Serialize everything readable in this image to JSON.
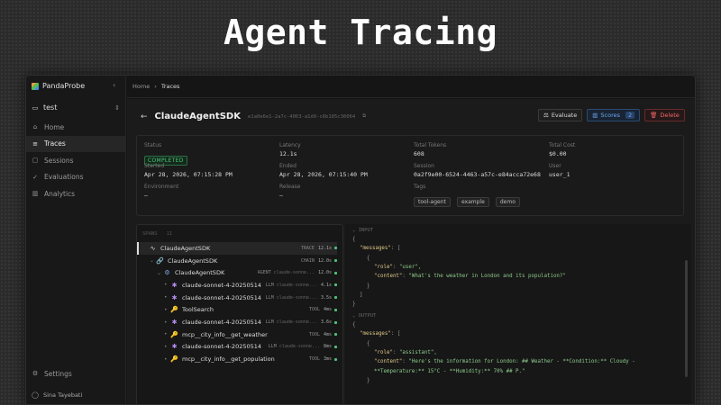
{
  "headline": "Agent Tracing",
  "brand": "PandaProbe",
  "project": "test",
  "nav": [
    {
      "label": "Home",
      "icon": "home-icon"
    },
    {
      "label": "Traces",
      "icon": "traces-icon"
    },
    {
      "label": "Sessions",
      "icon": "sessions-icon"
    },
    {
      "label": "Evaluations",
      "icon": "evaluations-icon"
    },
    {
      "label": "Analytics",
      "icon": "analytics-icon"
    }
  ],
  "settings_label": "Settings",
  "user_name": "Sina Tayebati",
  "breadcrumb": {
    "root": "Home",
    "sep": "›",
    "current": "Traces"
  },
  "trace": {
    "title": "ClaudeAgentSDK",
    "id": "e1a0e6e1-2a7c-4063-a1d9-c6b105c36064"
  },
  "actions": {
    "evaluate": "Evaluate",
    "scores": "Scores",
    "scores_count": "2",
    "delete": "Delete"
  },
  "meta": {
    "status_k": "Status",
    "status_v": "COMPLETED",
    "latency_k": "Latency",
    "latency_v": "12.1s",
    "tokens_k": "Total Tokens",
    "tokens_v": "608",
    "cost_k": "Total Cost",
    "cost_v": "$0.00",
    "started_k": "Started",
    "started_v": "Apr 28, 2026, 07:15:28 PM",
    "ended_k": "Ended",
    "ended_v": "Apr 28, 2026, 07:15:40 PM",
    "session_k": "Session",
    "session_v": "0a2f9e00-6524-4463-a57c-e84acca72e68",
    "user_k": "User",
    "user_v": "user_1",
    "env_k": "Environment",
    "env_v": "–",
    "release_k": "Release",
    "release_v": "–",
    "tags_k": "Tags",
    "tags": [
      "tool-agent",
      "example",
      "demo"
    ]
  },
  "tree_head": [
    "SPANS",
    "11"
  ],
  "spans": [
    {
      "name": "ClaudeAgentSDK",
      "type": "TRACE",
      "dur": "12.1s",
      "model": "",
      "icon": "trace-icon"
    },
    {
      "name": "ClaudeAgentSDK",
      "type": "CHAIN",
      "dur": "12.0s",
      "model": "",
      "icon": "chain-icon"
    },
    {
      "name": "ClaudeAgentSDK",
      "type": "AGENT",
      "dur": "12.0s",
      "model": "claude-sonne...",
      "icon": "agent-icon"
    },
    {
      "name": "claude-sonnet-4-20250514",
      "type": "LLM",
      "dur": "4.1s",
      "model": "claude-sonne...",
      "icon": "llm-icon"
    },
    {
      "name": "claude-sonnet-4-20250514",
      "type": "LLM",
      "dur": "3.5s",
      "model": "claude-sonne...",
      "icon": "llm-icon"
    },
    {
      "name": "ToolSearch",
      "type": "TOOL",
      "dur": "4ms",
      "model": "",
      "icon": "tool-icon"
    },
    {
      "name": "claude-sonnet-4-20250514",
      "type": "LLM",
      "dur": "3.6s",
      "model": "claude-sonne...",
      "icon": "llm-icon"
    },
    {
      "name": "mcp__city_info__get_weather",
      "type": "TOOL",
      "dur": "4ms",
      "model": "",
      "icon": "tool-icon"
    },
    {
      "name": "claude-sonnet-4-20250514",
      "type": "LLM",
      "dur": "8ms",
      "model": "claude-sonne...",
      "icon": "llm-icon"
    },
    {
      "name": "mcp__city_info__get_population",
      "type": "TOOL",
      "dur": "3ms",
      "model": "",
      "icon": "tool-icon"
    }
  ],
  "io": {
    "input_label": "INPUT",
    "output_label": "OUTPUT",
    "input_lines": [
      "{",
      "\"messages\": [",
      "{",
      "\"role\": \"user\",",
      "\"content\": \"What's the weather in London and its population?\"",
      "}",
      "]",
      "}"
    ],
    "output_lines": [
      "{",
      "\"messages\": [",
      "{",
      "\"role\": \"assistant\",",
      "\"content\": \"Here's the information for London: ## Weather - **Condition:** Cloudy -",
      "**Temperature:** 15°C - **Humidity:** 70% ## P.\"",
      "}"
    ]
  }
}
